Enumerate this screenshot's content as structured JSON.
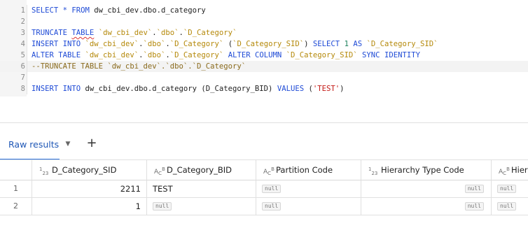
{
  "editor": {
    "line_numbers": [
      "1",
      "2",
      "3",
      "4",
      "5",
      "6",
      "7",
      "8"
    ],
    "lines": [
      [
        {
          "t": "SELECT * FROM ",
          "c": "kw"
        },
        {
          "t": "dw_cbi_dev.dbo.d_category",
          "c": "pl"
        }
      ],
      [],
      [
        {
          "t": "TRUNCATE ",
          "c": "kw"
        },
        {
          "t": "TABLE",
          "c": "kw",
          "u": true
        },
        {
          "t": " ",
          "c": "pl"
        },
        {
          "t": "`dw_cbi_dev`",
          "c": "st"
        },
        {
          "t": ".",
          "c": "pl"
        },
        {
          "t": "`dbo`",
          "c": "st"
        },
        {
          "t": ".",
          "c": "pl"
        },
        {
          "t": "`D_Category`",
          "c": "st"
        }
      ],
      [
        {
          "t": "INSERT INTO ",
          "c": "kw"
        },
        {
          "t": "`dw_cbi_dev`",
          "c": "st"
        },
        {
          "t": ".",
          "c": "pl"
        },
        {
          "t": "`dbo`",
          "c": "st"
        },
        {
          "t": ".",
          "c": "pl"
        },
        {
          "t": "`D_Category`",
          "c": "st"
        },
        {
          "t": " (",
          "c": "pl"
        },
        {
          "t": "`D_Category_SID`",
          "c": "st"
        },
        {
          "t": ") ",
          "c": "pl"
        },
        {
          "t": "SELECT ",
          "c": "kw"
        },
        {
          "t": "1",
          "c": "nm"
        },
        {
          "t": " AS ",
          "c": "kw"
        },
        {
          "t": "`D_Category_SID`",
          "c": "st"
        }
      ],
      [
        {
          "t": "ALTER TABLE ",
          "c": "kw"
        },
        {
          "t": "`dw_cbi_dev`",
          "c": "st"
        },
        {
          "t": ".",
          "c": "pl"
        },
        {
          "t": "`dbo`",
          "c": "st"
        },
        {
          "t": ".",
          "c": "pl"
        },
        {
          "t": "`D_Category`",
          "c": "st"
        },
        {
          "t": " ALTER COLUMN ",
          "c": "kw"
        },
        {
          "t": "`D_Category_SID`",
          "c": "st"
        },
        {
          "t": " SYNC IDENTITY",
          "c": "kw"
        }
      ],
      [
        {
          "t": "--TRUNCATE TABLE `dw_cbi_dev`.`dbo`.`D_Category`",
          "c": "cm"
        }
      ],
      [],
      [
        {
          "t": "INSERT INTO ",
          "c": "kw"
        },
        {
          "t": "dw_cbi_dev.dbo.d_category ",
          "c": "pl"
        },
        {
          "t": "(D_Category_BID) ",
          "c": "pl"
        },
        {
          "t": "VALUES ",
          "c": "kw"
        },
        {
          "t": "(",
          "c": "pl"
        },
        {
          "t": "'TEST'",
          "c": "rd"
        },
        {
          "t": ")",
          "c": "pl"
        }
      ]
    ],
    "active_line": 6
  },
  "results": {
    "tab_label": "Raw results",
    "chevron_icon": "chevron-down-icon",
    "add_icon": "plus-icon",
    "columns": [
      {
        "label": "D_Category_SID",
        "type_icon": "integer-type-icon"
      },
      {
        "label": "D_Category_BID",
        "type_icon": "string-type-icon"
      },
      {
        "label": "Partition Code",
        "type_icon": "string-type-icon"
      },
      {
        "label": "Hierarchy Type Code",
        "type_icon": "integer-type-icon"
      },
      {
        "label": "Hier",
        "type_icon": "string-type-icon"
      }
    ],
    "rows": [
      {
        "num": "1",
        "sid": "2211",
        "bid": "TEST",
        "partition": "null",
        "hier_type": "null",
        "hier": "null"
      },
      {
        "num": "2",
        "sid": "1",
        "bid": "null",
        "partition": "null",
        "hier_type": "null",
        "hier": "null"
      }
    ],
    "type_marks": {
      "integer": "123",
      "string": "ABC"
    }
  },
  "colors": {
    "keyword": "#1f4bd6",
    "string": "#b5890a",
    "number": "#1a7f5a",
    "literal": "#c41a16",
    "accent": "#2a6fdb"
  }
}
